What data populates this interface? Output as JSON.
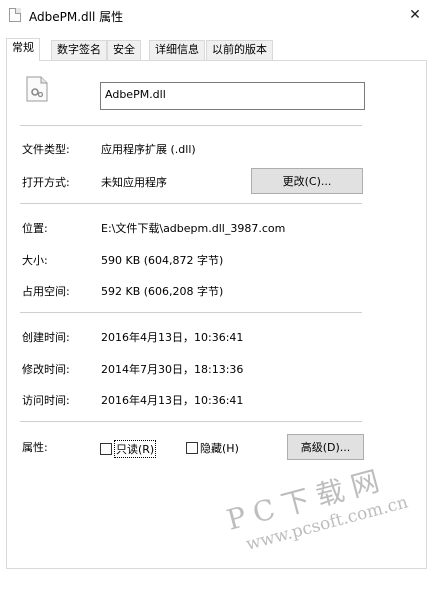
{
  "window": {
    "title": "AdbePM.dll 属性",
    "close_glyph": "✕"
  },
  "tabs": [
    {
      "label": "常规",
      "active": true
    },
    {
      "label": "数字签名",
      "active": false
    },
    {
      "label": "安全",
      "active": false
    },
    {
      "label": "详细信息",
      "active": false
    },
    {
      "label": "以前的版本",
      "active": false
    }
  ],
  "general": {
    "file_name": "AdbePM.dll",
    "file_type": {
      "label": "文件类型:",
      "value": "应用程序扩展 (.dll)"
    },
    "opens_with": {
      "label": "打开方式:",
      "value": "未知应用程序",
      "button": "更改(C)..."
    },
    "location": {
      "label": "位置:",
      "value": "E:\\文件下载\\adbepm.dll_3987.com"
    },
    "size": {
      "label": "大小:",
      "value": "590 KB (604,872 字节)"
    },
    "size_on_disk": {
      "label": "占用空间:",
      "value": "592 KB (606,208 字节)"
    },
    "created": {
      "label": "创建时间:",
      "value": "2016年4月13日，10:36:41"
    },
    "modified": {
      "label": "修改时间:",
      "value": "2014年7月30日，18:13:36"
    },
    "accessed": {
      "label": "访问时间:",
      "value": "2016年4月13日，10:36:41"
    },
    "attributes": {
      "label": "属性:",
      "readonly": {
        "label": "只读(R)",
        "checked": false
      },
      "hidden": {
        "label": "隐藏(H)",
        "checked": false
      },
      "advanced_button": "高级(D)..."
    }
  },
  "watermark": {
    "text": "PC下载网",
    "url": "www.pcsoft.com.cn"
  }
}
